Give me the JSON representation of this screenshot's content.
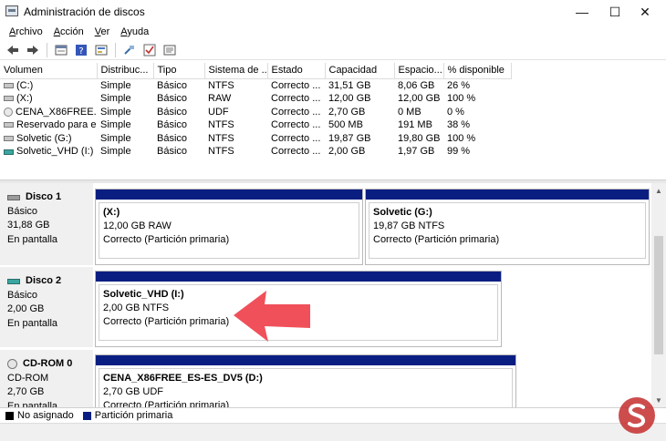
{
  "window": {
    "title": "Administración de discos",
    "icon": "disk-management-icon",
    "controls": {
      "minimize": "—",
      "maximize": "☐",
      "close": "✕"
    }
  },
  "menu": [
    {
      "label": "Archivo"
    },
    {
      "label": "Acción"
    },
    {
      "label": "Ver"
    },
    {
      "label": "Ayuda"
    }
  ],
  "toolbar": {
    "buttons": [
      "back-icon",
      "forward-icon",
      "properties-icon",
      "help-icon",
      "refresh-icon",
      "rescan-icon",
      "check-icon",
      "settings-icon"
    ]
  },
  "volumes": {
    "columns": [
      "Volumen",
      "Distribuc...",
      "Tipo",
      "Sistema de ...",
      "Estado",
      "Capacidad",
      "Espacio...",
      "% disponible"
    ],
    "rows": [
      {
        "volume": "(C:)",
        "layout": "Simple",
        "type": "Básico",
        "fs": "NTFS",
        "status": "Correcto ...",
        "capacity": "31,51 GB",
        "free": "8,06 GB",
        "pct": "26 %",
        "icon": "drive"
      },
      {
        "volume": "(X:)",
        "layout": "Simple",
        "type": "Básico",
        "fs": "RAW",
        "status": "Correcto ...",
        "capacity": "12,00 GB",
        "free": "12,00 GB",
        "pct": "100 %",
        "icon": "drive"
      },
      {
        "volume": "CENA_X86FREE...",
        "layout": "Simple",
        "type": "Básico",
        "fs": "UDF",
        "status": "Correcto ...",
        "capacity": "2,70 GB",
        "free": "0 MB",
        "pct": "0 %",
        "icon": "cd"
      },
      {
        "volume": "Reservado para el...",
        "layout": "Simple",
        "type": "Básico",
        "fs": "NTFS",
        "status": "Correcto ...",
        "capacity": "500 MB",
        "free": "191 MB",
        "pct": "38 %",
        "icon": "drive"
      },
      {
        "volume": "Solvetic (G:)",
        "layout": "Simple",
        "type": "Básico",
        "fs": "NTFS",
        "status": "Correcto ...",
        "capacity": "19,87 GB",
        "free": "19,80 GB",
        "pct": "100 %",
        "icon": "drive"
      },
      {
        "volume": "Solvetic_VHD (I:)",
        "layout": "Simple",
        "type": "Básico",
        "fs": "NTFS",
        "status": "Correcto ...",
        "capacity": "2,00 GB",
        "free": "1,97 GB",
        "pct": "99 %",
        "icon": "vhd"
      }
    ]
  },
  "disks": [
    {
      "name": "Disco 1",
      "kind": "Básico",
      "size": "31,88 GB",
      "state": "En pantalla",
      "partitions": [
        {
          "name": "(X:)",
          "size": "12,00 GB RAW",
          "status": "Correcto (Partición primaria)"
        },
        {
          "name": "Solvetic  (G:)",
          "size": "19,87 GB NTFS",
          "status": "Correcto (Partición primaria)"
        }
      ]
    },
    {
      "name": "Disco 2",
      "kind": "Básico",
      "size": "2,00 GB",
      "state": "En pantalla",
      "partitions": [
        {
          "name": "Solvetic_VHD  (I:)",
          "size": "2,00 GB NTFS",
          "status": "Correcto (Partición primaria)"
        }
      ]
    },
    {
      "name": "CD-ROM 0",
      "kind": "CD-ROM",
      "size": "2,70 GB",
      "state": "En pantalla",
      "partitions": [
        {
          "name": "CENA_X86FREE_ES-ES_DV5  (D:)",
          "size": "2,70 GB UDF",
          "status": "Correcto (Partición primaria)"
        }
      ]
    }
  ],
  "legend": [
    {
      "label": "No asignado",
      "color": "#000000"
    },
    {
      "label": "Partición primaria",
      "color": "#0a1e82"
    }
  ],
  "colors": {
    "primary_partition": "#0a1e82",
    "arrow": "#f0505a",
    "watermark": "#c42e2e"
  }
}
